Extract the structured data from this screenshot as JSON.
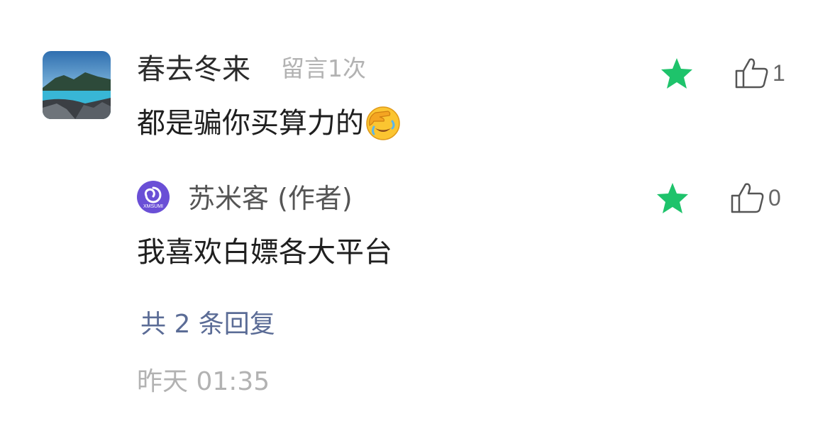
{
  "comment": {
    "username": "春去冬来",
    "message_count": "留言1次",
    "text": "都是骗你买算力的",
    "emoji": "face-palm-emoji",
    "like_count": "1",
    "star_color": "#1ec36b"
  },
  "reply": {
    "author": "苏米客 (作者)",
    "avatar_label": "XMSUMI",
    "text": "我喜欢白嫖各大平台",
    "like_count": "0"
  },
  "footer": {
    "reply_count": "共 2 条回复",
    "timestamp": "昨天 01:35"
  },
  "colors": {
    "accent_blue": "#5b6c96",
    "star_green": "#1ec36b",
    "author_avatar_purple": "#6a4fd6"
  }
}
